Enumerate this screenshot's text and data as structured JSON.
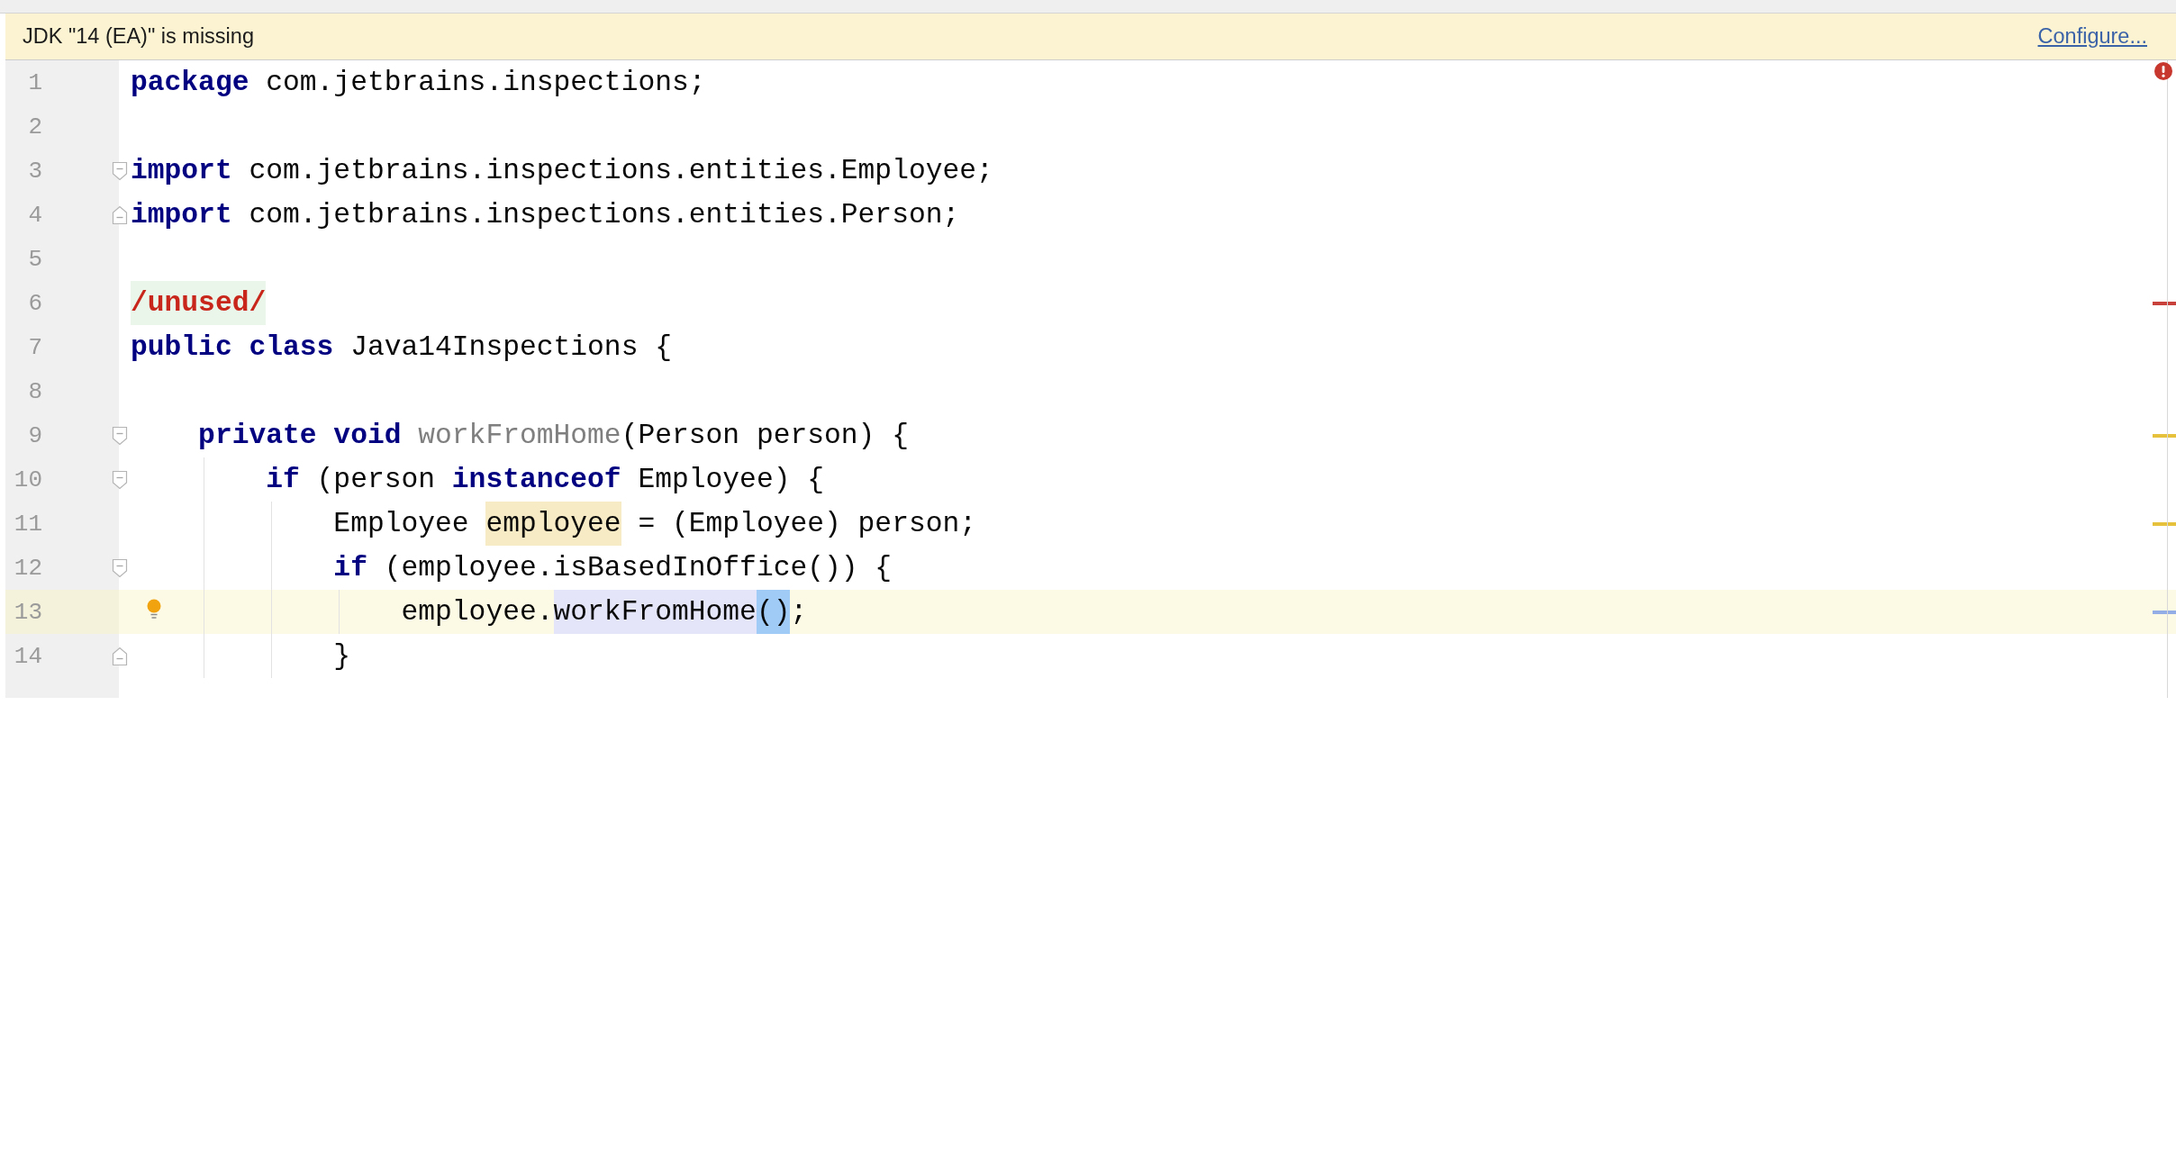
{
  "banner": {
    "message": "JDK \"14 (EA)\" is missing",
    "action": "Configure..."
  },
  "editor": {
    "lines": [
      {
        "number": "1",
        "current": false,
        "bulb": false,
        "fold_start": false,
        "fold_end": false,
        "tokens": [
          {
            "text": "package",
            "kind": "keyword"
          },
          {
            "text": " com.jetbrains.inspections;",
            "kind": "plain"
          }
        ]
      },
      {
        "number": "2",
        "current": false,
        "bulb": false,
        "fold_start": false,
        "fold_end": false
      },
      {
        "number": "3",
        "current": false,
        "bulb": false,
        "fold_start": true,
        "fold_end": false,
        "tokens": [
          {
            "text": "import",
            "kind": "keyword"
          },
          {
            "text": " com.jetbrains.inspections.entities.Employee;",
            "kind": "plain"
          }
        ]
      },
      {
        "number": "4",
        "current": false,
        "bulb": false,
        "fold_start": false,
        "fold_end": true,
        "tokens": [
          {
            "text": "import",
            "kind": "keyword"
          },
          {
            "text": " com.jetbrains.inspections.entities.Person;",
            "kind": "plain"
          }
        ]
      },
      {
        "number": "5",
        "current": false,
        "bulb": false,
        "fold_start": false,
        "fold_end": false
      },
      {
        "number": "6",
        "current": false,
        "bulb": false,
        "fold_start": false,
        "fold_end": false,
        "color": "#c8413a",
        "tokens": [
          {
            "text": "/unused/",
            "kind": "unused_marker"
          }
        ]
      },
      {
        "number": "7",
        "current": false,
        "bulb": false,
        "fold_start": false,
        "fold_end": false,
        "tokens": [
          {
            "text": "public",
            "kind": "keyword"
          },
          {
            "text": " class",
            "kind": "keyword"
          },
          {
            "text": " Java14Inspections {",
            "kind": "plain"
          }
        ]
      },
      {
        "number": "8",
        "current": false,
        "bulb": false,
        "fold_start": false,
        "fold_end": false
      },
      {
        "number": "9",
        "current": false,
        "bulb": false,
        "fold_start": true,
        "fold_end": false,
        "color": "#e6c23c",
        "tokens": [
          {
            "text": "    private",
            "kind": "keyword"
          },
          {
            "text": " void",
            "kind": "keyword"
          },
          {
            "text": " workFromHome",
            "kind": "unused"
          },
          {
            "text": "(Person person) {",
            "kind": "plain"
          }
        ]
      },
      {
        "number": "10",
        "current": false,
        "bulb": false,
        "fold_start": true,
        "fold_end": false,
        "tokens": [
          {
            "text": "        if",
            "kind": "keyword"
          },
          {
            "text": " (person ",
            "kind": "plain"
          },
          {
            "text": "instanceof",
            "kind": "keyword"
          },
          {
            "text": " Employee) {",
            "kind": "plain"
          }
        ]
      },
      {
        "number": "11",
        "current": false,
        "bulb": false,
        "fold_start": false,
        "fold_end": false,
        "color": "#e6c23c",
        "tokens": [
          {
            "text": "            Employee ",
            "kind": "plain"
          },
          {
            "text": "employee",
            "kind": "variable_highlight"
          },
          {
            "text": " = (Employee) person;",
            "kind": "plain"
          }
        ]
      },
      {
        "number": "12",
        "current": false,
        "bulb": false,
        "fold_start": true,
        "fold_end": false,
        "tokens": [
          {
            "text": "            if",
            "kind": "keyword"
          },
          {
            "text": " (employee.isBasedInOffice()) {",
            "kind": "plain"
          }
        ]
      },
      {
        "number": "13",
        "current": true,
        "bulb": true,
        "fold_start": false,
        "fold_end": false,
        "color": "#93aee6",
        "tokens": [
          {
            "text": "                employee.",
            "kind": "plain"
          },
          {
            "text": "workFromHome",
            "kind": "usage_highlight"
          },
          {
            "text": "()",
            "kind": "brace_match"
          },
          {
            "text": ";",
            "kind": "plain"
          }
        ]
      },
      {
        "number": "14",
        "current": false,
        "bulb": false,
        "fold_start": false,
        "fold_end": true,
        "tokens": [
          {
            "text": "            }",
            "kind": "plain"
          }
        ]
      }
    ]
  }
}
